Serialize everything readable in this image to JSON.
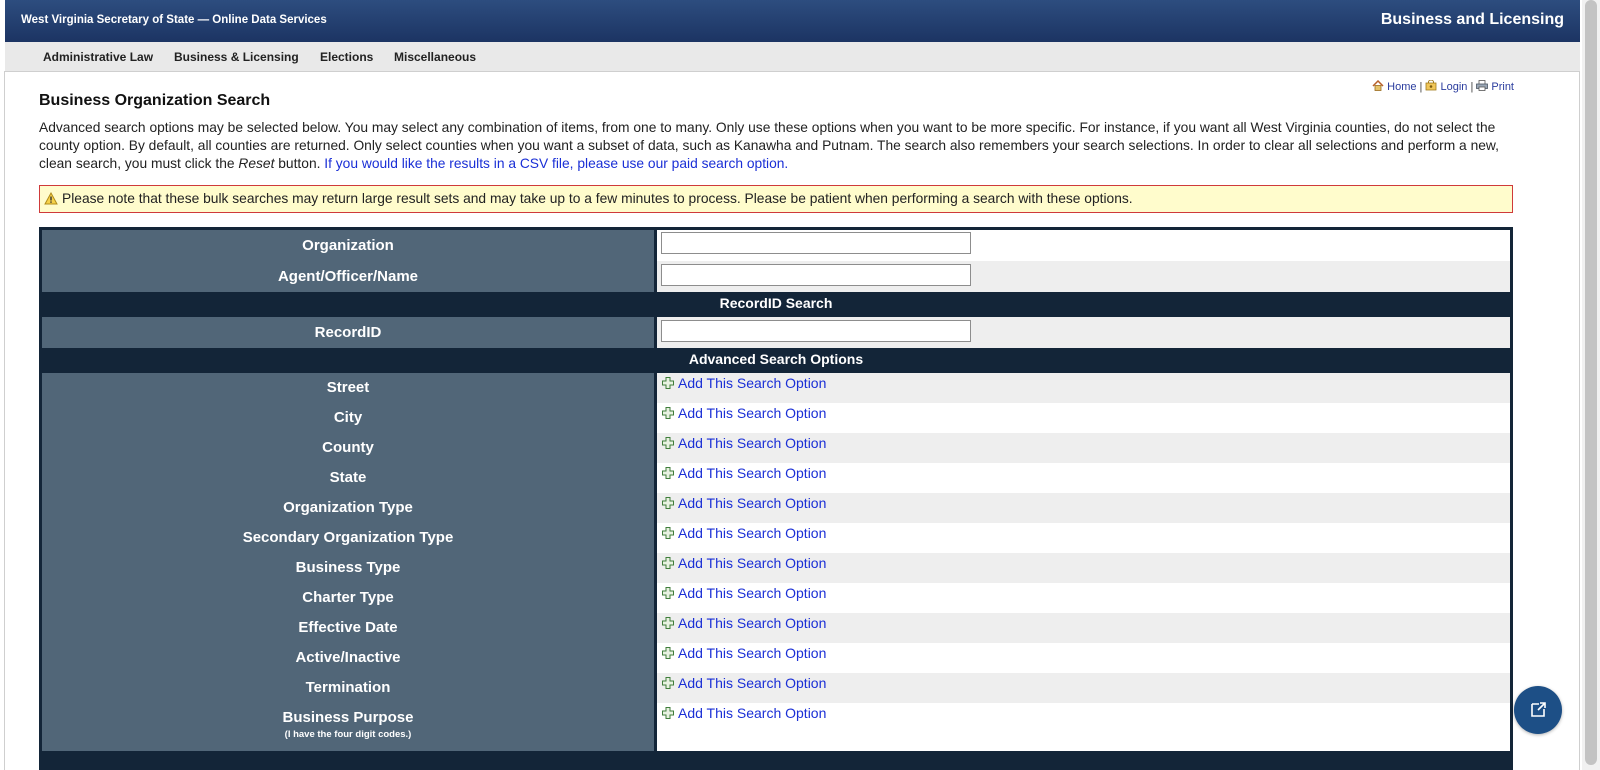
{
  "header": {
    "site_title": "West Virginia Secretary of State — Online Data Services",
    "section_title": "Business and Licensing"
  },
  "nav": {
    "items": [
      "Administrative Law",
      "Business & Licensing",
      "Elections",
      "Miscellaneous"
    ]
  },
  "utility": {
    "home": "Home",
    "login": "Login",
    "print": "Print",
    "separator": "|"
  },
  "page": {
    "title": "Business Organization Search",
    "intro_text": "Advanced search options may be selected below. You may select any combination of items, from one to many. Only use these options when you want to be more specific. For instance, if you want all West Virginia counties, do not select the county option. By default, all counties are returned. Only select counties when you want a subset of data, such as Kanawha and Putnam. The search also remembers your search selections. In order to clear all selections and perform a new, clean search, you must click the ",
    "intro_reset": "Reset",
    "intro_after": " button. ",
    "intro_link": "If you would like the results in a CSV file, please use our paid search option.",
    "notice": "Please note that these bulk searches may return large result sets and may take up to a few minutes to process. Please be patient when performing a search with these options."
  },
  "form": {
    "organization_label": "Organization",
    "organization_value": "",
    "agent_label": "Agent/Officer/Name",
    "agent_value": "",
    "recordid_header": "RecordID Search",
    "recordid_label": "RecordID",
    "recordid_value": "",
    "advanced_header": "Advanced Search Options",
    "add_option_label": "Add This Search Option",
    "advanced_options": [
      "Street",
      "City",
      "County",
      "State",
      "Organization Type",
      "Secondary Organization Type",
      "Business Type",
      "Charter Type",
      "Effective Date",
      "Active/Inactive",
      "Termination",
      "Business Purpose"
    ],
    "business_purpose_note": "(I have the four digit codes.)"
  },
  "colors": {
    "header_blue": "#1c3463",
    "label_slate": "#516678",
    "section_navy": "#132538",
    "link_blue": "#1a2fd6",
    "notice_bg": "#fffccc",
    "notice_border": "#cf3a3a"
  },
  "icons": {
    "home": "home-icon",
    "login": "login-icon",
    "print": "print-icon",
    "warning": "warning-icon",
    "add": "plus-icon",
    "chat": "chat-icon"
  }
}
